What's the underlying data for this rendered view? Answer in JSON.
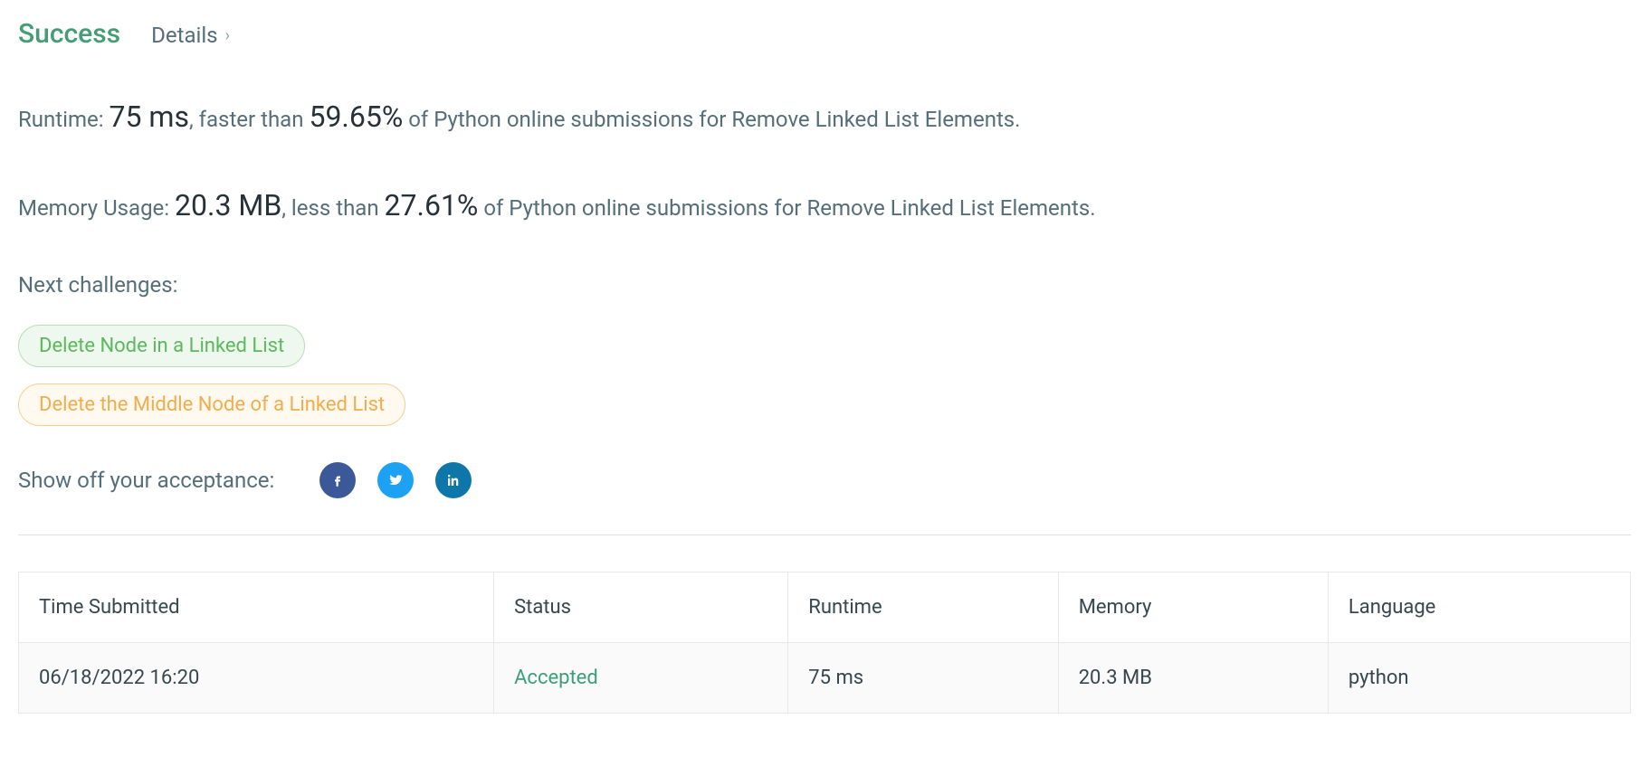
{
  "header": {
    "status": "Success",
    "details_label": "Details"
  },
  "runtime": {
    "label": "Runtime: ",
    "value": "75 ms",
    "comma_faster": ", faster than ",
    "percent": "59.65%",
    "tail": " of Python online submissions for Remove Linked List Elements."
  },
  "memory": {
    "label": "Memory Usage: ",
    "value": "20.3 MB",
    "comma_less": ", less than ",
    "percent": "27.61%",
    "tail": " of Python online submissions for Remove Linked List Elements."
  },
  "next": {
    "label": "Next challenges:",
    "items": [
      "Delete Node in a Linked List",
      "Delete the Middle Node of a Linked List"
    ]
  },
  "share": {
    "label": "Show off your acceptance:"
  },
  "table": {
    "headers": {
      "time": "Time Submitted",
      "status": "Status",
      "runtime": "Runtime",
      "memory": "Memory",
      "language": "Language"
    },
    "rows": [
      {
        "time": "06/18/2022 16:20",
        "status": "Accepted",
        "runtime": "75 ms",
        "memory": "20.3 MB",
        "language": "python"
      }
    ]
  }
}
